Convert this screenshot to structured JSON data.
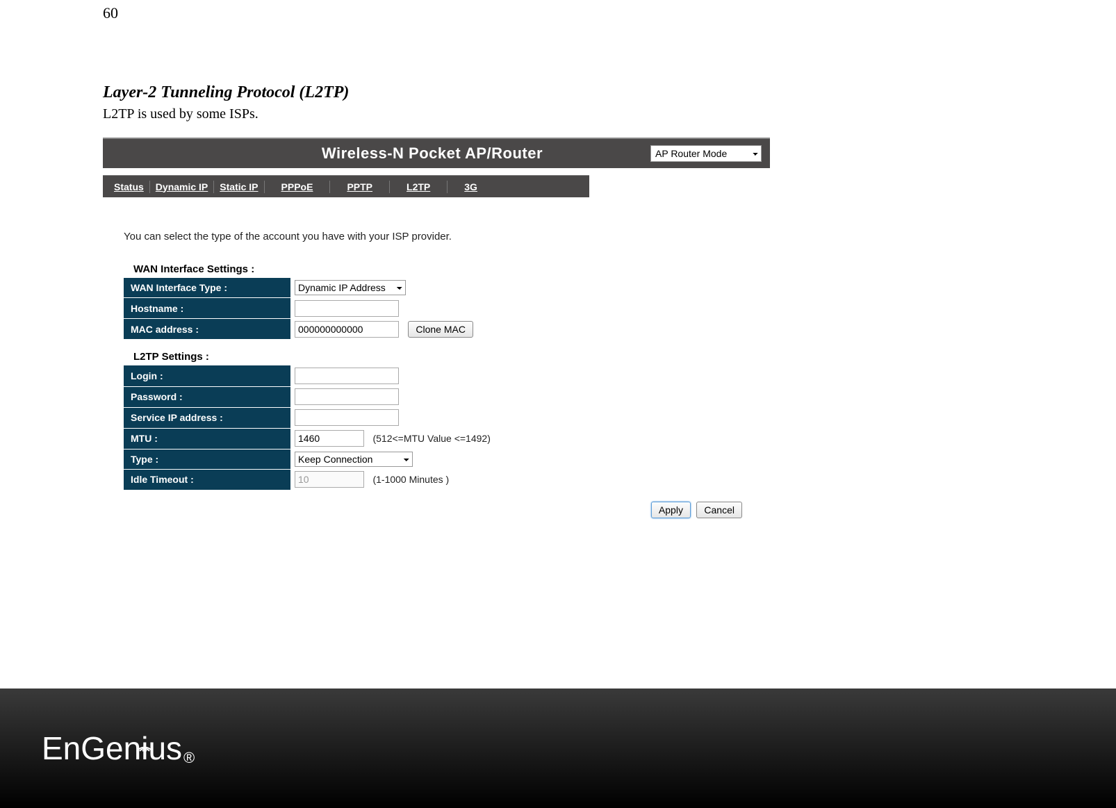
{
  "page_number": "60",
  "section": {
    "title": "Layer-2 Tunneling Protocol (L2TP)",
    "description": "L2TP is used by some ISPs."
  },
  "header": {
    "title": "Wireless-N Pocket AP/Router",
    "mode_select": "AP Router Mode"
  },
  "tabs": {
    "status": "Status",
    "dynamic_ip": "Dynamic IP",
    "static_ip": "Static IP",
    "pppoe": "PPPoE",
    "pptp": "PPTP",
    "l2tp": "L2TP",
    "threeg": "3G"
  },
  "intro": "You can select the type of the account you have with your ISP provider.",
  "wan_settings": {
    "group_title": "WAN Interface Settings :",
    "labels": {
      "wan_type": "WAN Interface Type :",
      "hostname": "Hostname :",
      "mac": "MAC address :"
    },
    "wan_type_value": "Dynamic IP Address",
    "hostname_value": "",
    "mac_value": "000000000000",
    "clone_mac_btn": "Clone MAC"
  },
  "l2tp_settings": {
    "group_title": "L2TP Settings :",
    "labels": {
      "login": "Login :",
      "password": "Password :",
      "service_ip": "Service IP address :",
      "mtu": "MTU :",
      "type": "Type :",
      "idle": "Idle Timeout :"
    },
    "login_value": "",
    "password_value": "",
    "service_ip_value": "",
    "mtu_value": "1460",
    "mtu_hint": "(512<=MTU Value <=1492)",
    "type_value": "Keep Connection",
    "idle_value": "10",
    "idle_hint": "(1-1000 Minutes )"
  },
  "actions": {
    "apply": "Apply",
    "cancel": "Cancel"
  },
  "footer": {
    "brand": "EnGenius",
    "reg": "®"
  }
}
